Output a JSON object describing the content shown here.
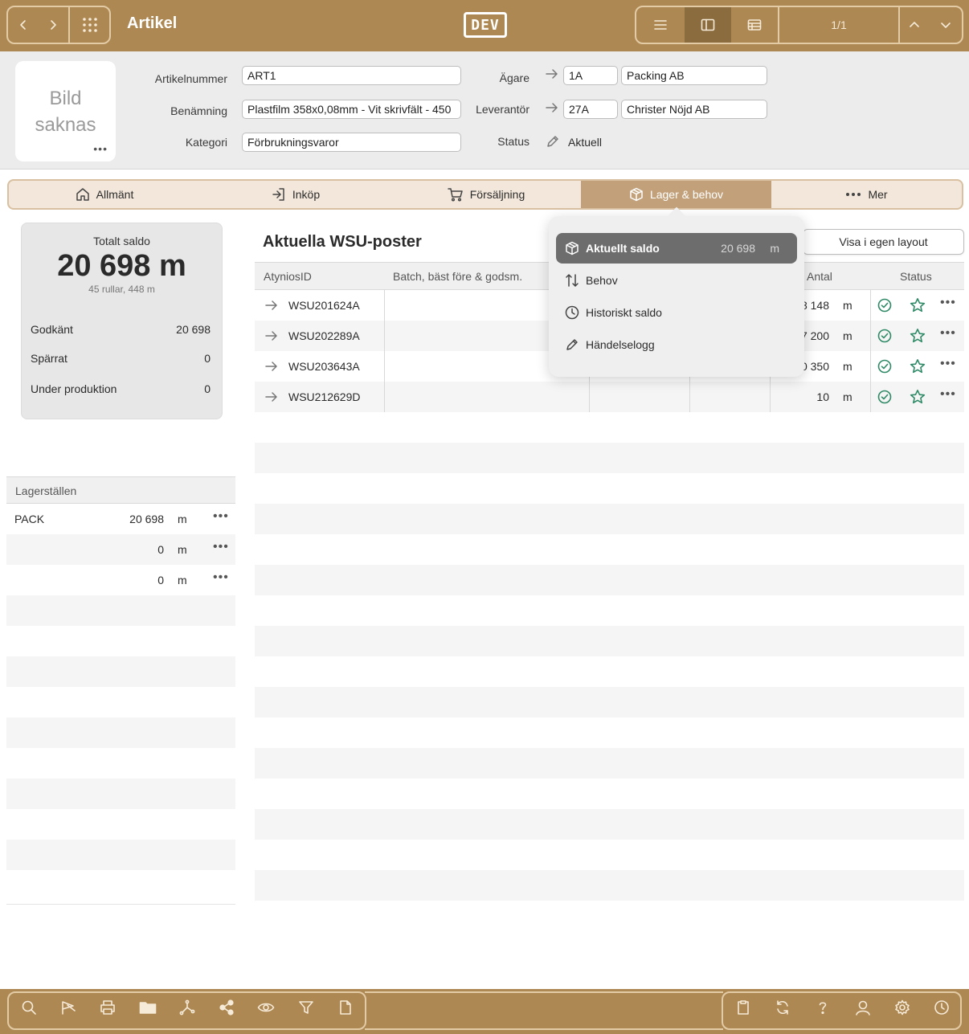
{
  "topbar": {
    "title": "Artikel",
    "logo": "DEV",
    "pager": "1/1",
    "icons": [
      "back-icon",
      "forward-icon",
      "grid-menu-icon",
      "list-view-icon",
      "split-view-icon",
      "table-view-icon",
      "chevron-up-icon",
      "chevron-down-icon"
    ]
  },
  "header": {
    "image_placeholder": [
      "Bild",
      "saknas"
    ],
    "image_more": "•••",
    "labels": {
      "artikelnummer": "Artikelnummer",
      "benamning": "Benämning",
      "kategori": "Kategori",
      "agare": "Ägare",
      "leverantor": "Leverantör",
      "status": "Status"
    },
    "values": {
      "artikelnummer": "ART1",
      "benamning": "Plastfilm 358x0,08mm - Vit skrivfält - 450",
      "kategori": "Förbrukningsvaror",
      "agare_code": "1A",
      "agare_name": "Packing AB",
      "leverantor_code": "27A",
      "leverantor_name": "Christer Nöjd AB",
      "status": "Aktuell"
    }
  },
  "tabs": [
    {
      "label": "Allmänt",
      "icon": "home-icon"
    },
    {
      "label": "Inköp",
      "icon": "login-icon"
    },
    {
      "label": "Försäljning",
      "icon": "cart-icon"
    },
    {
      "label": "Lager & behov",
      "icon": "box-icon",
      "active": true
    },
    {
      "label": "Mer",
      "icon": "more-icon"
    }
  ],
  "saldo": {
    "caption": "Totalt saldo",
    "total": "20 698 m",
    "subtext": "45 rullar, 448 m",
    "rows": [
      {
        "label": "Godkänt",
        "value": "20 698"
      },
      {
        "label": "Spärrat",
        "value": "0"
      },
      {
        "label": "Under produktion",
        "value": "0"
      }
    ]
  },
  "lagerstallen": {
    "header": "Lagerställen",
    "rows": [
      {
        "name": "PACK",
        "qty": "20 698",
        "unit": "m",
        "more": "•••"
      },
      {
        "name": "",
        "qty": "0",
        "unit": "m",
        "more": "•••"
      },
      {
        "name": "",
        "qty": "0",
        "unit": "m",
        "more": "•••"
      }
    ]
  },
  "main": {
    "title": "Aktuella WSU-poster",
    "visa_button": "Visa i egen layout",
    "columns": [
      "AtyniosID",
      "Batch, bäst före & godsm.",
      "Antal",
      "Status"
    ],
    "rows": [
      {
        "id": "WSU201624A",
        "antal": "8 148",
        "unit": "m",
        "more": "•••"
      },
      {
        "id": "WSU202289A",
        "antal": "7 200",
        "unit": "m",
        "more": "•••"
      },
      {
        "id": "WSU203643A",
        "antal": "0 350",
        "unit": "m",
        "more": "•••"
      },
      {
        "id": "WSU212629D",
        "antal": "10",
        "unit": "m",
        "more": "•••"
      }
    ]
  },
  "menu": {
    "items": [
      {
        "label": "Aktuellt saldo",
        "value": "20 698",
        "unit": "m",
        "icon": "box-icon",
        "selected": true
      },
      {
        "label": "Behov",
        "icon": "sort-arrows-icon"
      },
      {
        "label": "Historiskt saldo",
        "icon": "clock-icon"
      },
      {
        "label": "Händelselogg",
        "icon": "pencil-icon"
      }
    ]
  },
  "bottombar": {
    "left_icons": [
      "search-icon",
      "flag-icon",
      "printer-icon",
      "folder-icon",
      "routing-icon",
      "share-icon",
      "eye-icon",
      "filter-icon",
      "document-icon"
    ],
    "right_icons": [
      "clipboard-icon",
      "refresh-icon",
      "help-icon",
      "user-icon",
      "settings-icon",
      "history-icon"
    ]
  },
  "colors": {
    "brand": "#ad8853",
    "brand_dark": "#8b6c3f",
    "tab_active": "#c2a17a",
    "status_ok": "#2e8a66",
    "menu_selected": "#6d6d6d"
  }
}
